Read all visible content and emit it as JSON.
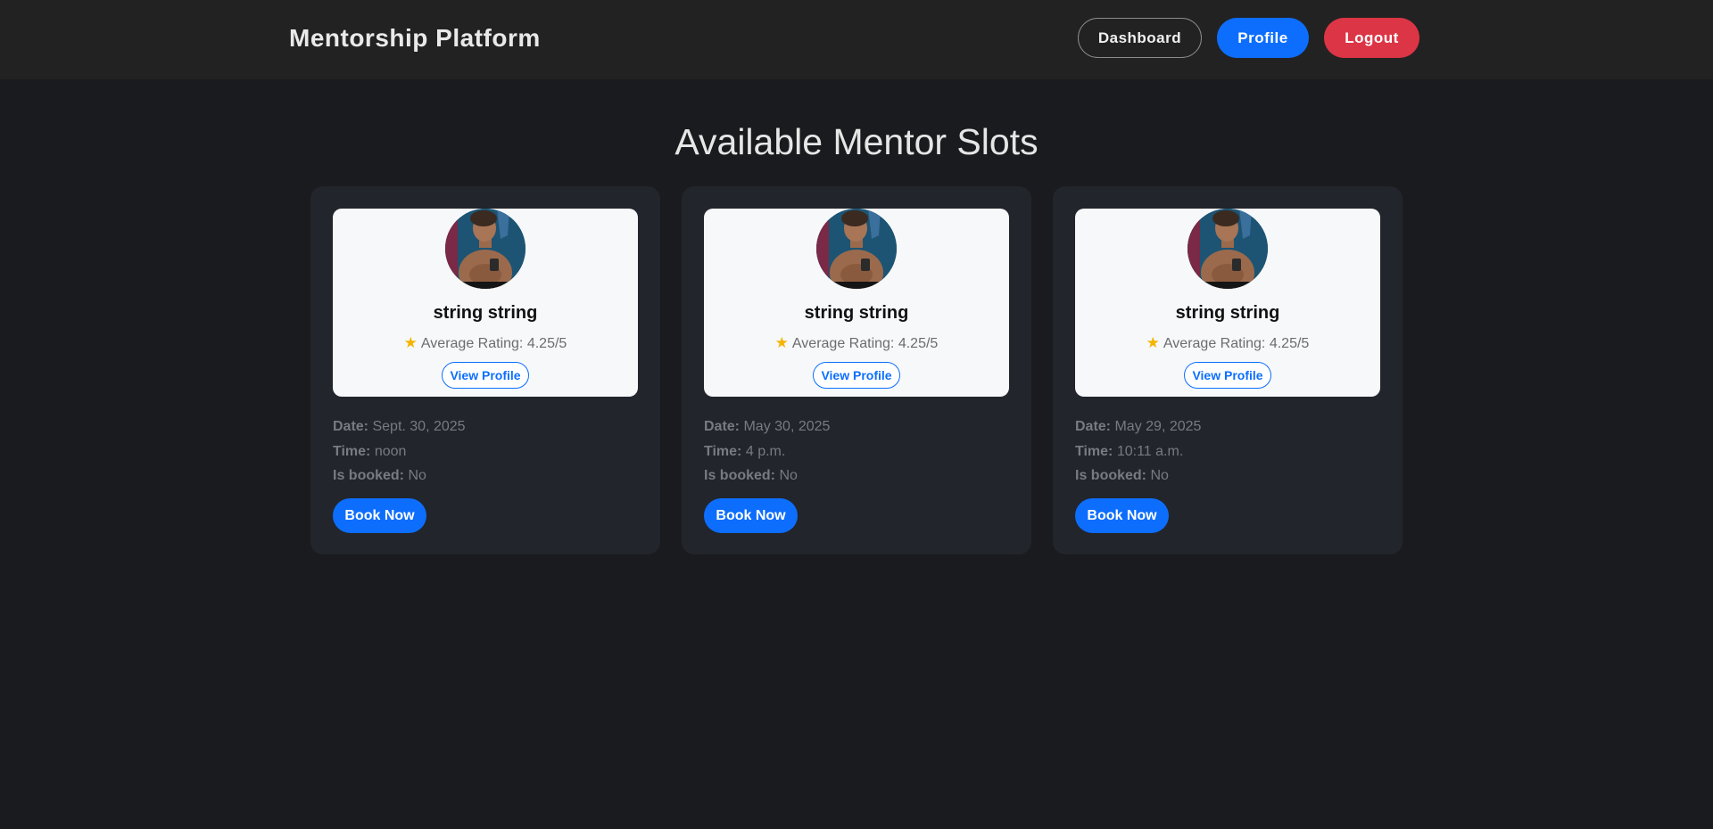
{
  "nav": {
    "brand": "Mentorship Platform",
    "dashboard_label": "Dashboard",
    "profile_label": "Profile",
    "logout_label": "Logout"
  },
  "page": {
    "title": "Available Mentor Slots"
  },
  "labels": {
    "date": "Date:",
    "time": "Time:",
    "is_booked": "Is booked:",
    "rating_prefix": "Average Rating:",
    "view_profile": "View Profile",
    "book_now": "Book Now"
  },
  "colors": {
    "primary": "#0d6efd",
    "danger": "#dc3545",
    "star": "#f5b400"
  },
  "slots": [
    {
      "mentor_name": "string string",
      "rating": "4.25/5",
      "star_icon": "star-icon",
      "date": "Sept. 30, 2025",
      "time": "noon",
      "is_booked": "No"
    },
    {
      "mentor_name": "string string",
      "rating": "4.25/5",
      "star_icon": "star-icon",
      "date": "May 30, 2025",
      "time": "4 p.m.",
      "is_booked": "No"
    },
    {
      "mentor_name": "string string",
      "rating": "4.25/5",
      "star_icon": "star-icon",
      "date": "May 29, 2025",
      "time": "10:11 a.m.",
      "is_booked": "No"
    }
  ]
}
